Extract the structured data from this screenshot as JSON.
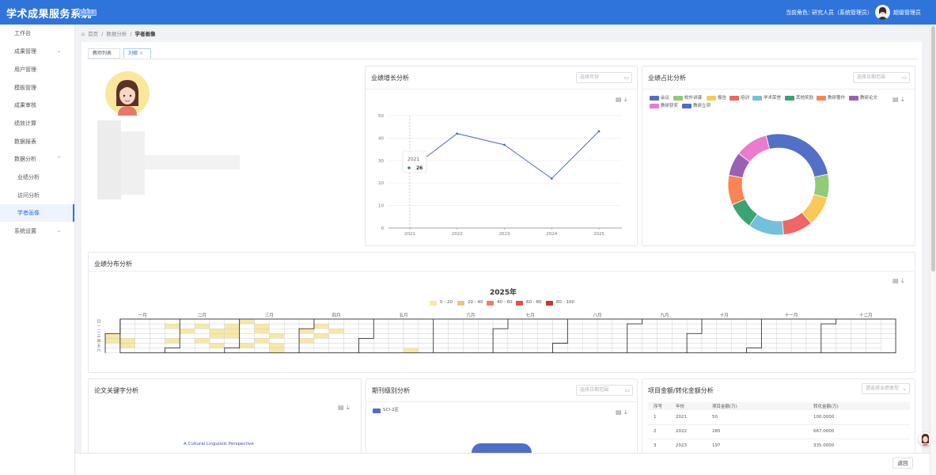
{
  "header": {
    "app_title": "学术成果服务系统",
    "version": "v1.0.0",
    "role_label": "当前角色：",
    "role_value": "研究人员（系统管理员）",
    "user_name": "超级管理员"
  },
  "sidebar": {
    "items": [
      {
        "label": "工作台"
      },
      {
        "label": "成果管理",
        "chevron": "⌄"
      },
      {
        "label": "用户管理"
      },
      {
        "label": "模板管理"
      },
      {
        "label": "成果审核"
      },
      {
        "label": "绩效计算"
      },
      {
        "label": "数据报表"
      },
      {
        "label": "数据分析",
        "chevron": "⌃"
      },
      {
        "label": "业绩分析"
      },
      {
        "label": "访问分析"
      },
      {
        "label": "学者画像"
      },
      {
        "label": "系统设置",
        "chevron": "⌄"
      }
    ]
  },
  "breadcrumb": {
    "home": "首页",
    "level1": "数据分析",
    "current": "学者画像",
    "sep": "/"
  },
  "tabs": {
    "teacher_list": "教师列表",
    "scholar": "刘娜",
    "close": "×"
  },
  "icons": {
    "home": "home-icon",
    "calendar": "calendar-icon",
    "doc": "document-icon",
    "download": "download-icon"
  },
  "growth_panel": {
    "title": "业绩增长分析",
    "year_placeholder": "选择年份",
    "tooltip_year": "2021",
    "tooltip_value": "26"
  },
  "share_panel": {
    "title": "业绩占比分析",
    "date_placeholder": "选择日期范围"
  },
  "distribution_panel": {
    "title": "业绩分布分析",
    "year_title": "2025年",
    "weekday_labels": [
      "日",
      "一",
      "二",
      "三",
      "四",
      "五",
      "六"
    ]
  },
  "keyword_panel": {
    "title": "论文关键字分析",
    "keyword_text": "A Cultural Linguistic Perspective"
  },
  "journal_panel": {
    "title": "期刊级别分析",
    "date_placeholder": "选择日期范围",
    "legend": "SCI-2区"
  },
  "amount_panel": {
    "title": "项目金额/转化金额分析",
    "type_placeholder": "请选择业绩类型",
    "columns": [
      "序号",
      "年份",
      "项目金额(万)",
      "转化金额(万)"
    ],
    "rows": [
      [
        "1",
        "2021",
        "50",
        "100.0000"
      ],
      [
        "2",
        "2022",
        "285",
        "667.0000"
      ],
      [
        "3",
        "2023",
        "197",
        "335.0000"
      ]
    ]
  },
  "bottom": {
    "back_label": "返回"
  },
  "chart_data": [
    {
      "type": "line",
      "x": [
        "2021",
        "2022",
        "2023",
        "2024",
        "2025"
      ],
      "y": [
        26,
        42,
        37,
        22,
        43
      ],
      "ylim": [
        0,
        50
      ],
      "yticks": [
        0,
        10,
        20,
        30,
        40,
        50
      ],
      "color": "#4e6ec7"
    },
    {
      "type": "pie",
      "legend": [
        {
          "name": "会议",
          "color": "#5470c6"
        },
        {
          "name": "校外讲课",
          "color": "#91cc75"
        },
        {
          "name": "报告",
          "color": "#fac858"
        },
        {
          "name": "培训",
          "color": "#ee6666"
        },
        {
          "name": "学术荣誉",
          "color": "#73c0de"
        },
        {
          "name": "其他奖励",
          "color": "#3ba272"
        },
        {
          "name": "教研著作",
          "color": "#fc8452"
        },
        {
          "name": "教研论文",
          "color": "#9a60b4"
        },
        {
          "name": "教研获奖",
          "color": "#ea7ccc"
        },
        {
          "name": "教研立项",
          "color": "#4e6ec7"
        }
      ],
      "values": [
        27,
        8,
        10,
        10,
        12,
        9,
        10,
        8,
        11
      ]
    },
    {
      "type": "heatmap",
      "title": "2025年",
      "months": [
        "一月",
        "二月",
        "三月",
        "四月",
        "五月",
        "六月",
        "七月",
        "八月",
        "九月",
        "十月",
        "十一月",
        "十二月"
      ],
      "ranges": [
        {
          "label": "0 - 20",
          "color": "#f6e8a6"
        },
        {
          "label": "20 - 40",
          "color": "#f0c08a"
        },
        {
          "label": "40 - 60",
          "color": "#e8836a"
        },
        {
          "label": "60 - 80",
          "color": "#d9534f"
        },
        {
          "label": "80 - 100",
          "color": "#c0392b"
        }
      ]
    }
  ]
}
